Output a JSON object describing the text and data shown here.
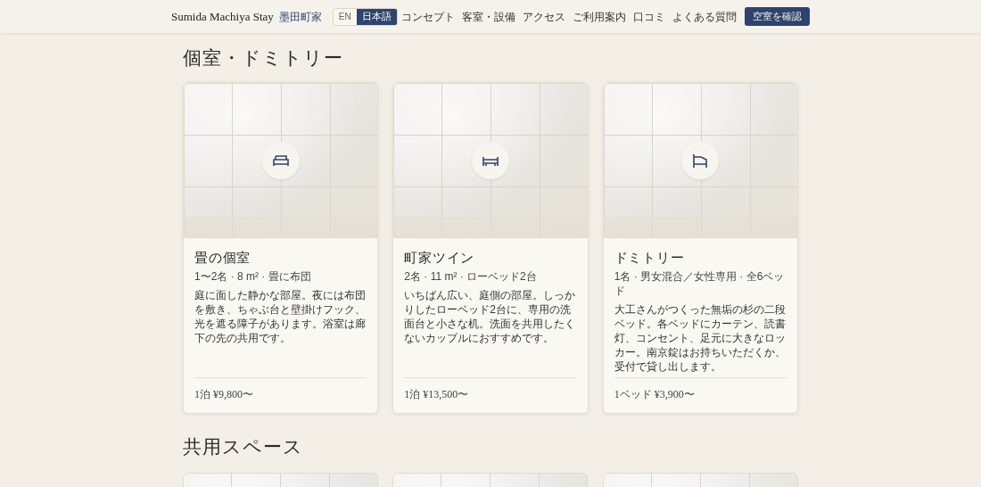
{
  "header": {
    "brand": "Sumida Machiya Stay",
    "brand_ja": "墨田町家",
    "languages": [
      {
        "label": "EN",
        "selected": false
      },
      {
        "label": "日本語",
        "selected": true
      }
    ],
    "nav": [
      "コンセプト",
      "客室・設備",
      "アクセス",
      "ご利用案内",
      "口コミ",
      "よくある質問"
    ],
    "cta": "空室を確認"
  },
  "rooms": {
    "heading": "個室・ドミトリー",
    "cards": [
      {
        "kind": "futon",
        "title": "畳の個室",
        "meta": "1〜2名 · 8 m² · 畳に布団",
        "description": "庭に面した静かな部屋。夜には布団を敷き、ちゃぶ台と壁掛けフック、光を遮る障子があります。浴室は廊下の先の共用です。",
        "price": "1泊 ¥9,800〜"
      },
      {
        "kind": "twin",
        "title": "町家ツイン",
        "meta": "2名 · 11 m² · ローベッド2台",
        "description": "いちばん広い、庭側の部屋。しっかりしたローベッド2台に、専用の洗面台と小さな机。洗面を共用したくないカップルにおすすめです。",
        "price": "1泊 ¥13,500〜"
      },
      {
        "kind": "bunk",
        "title": "ドミトリー",
        "meta": "1名 · 男女混合／女性専用 · 全6ベッド",
        "description": "大工さんがつくった無垢の杉の二段ベッド。各ベッドにカーテン、読書灯、コンセント、足元に大きなロッカー。南京錠はお持ちいただくか、受付で貸し出します。",
        "price": "1ベッド ¥3,900〜"
      }
    ]
  },
  "shared": {
    "heading": "共用スペース"
  }
}
